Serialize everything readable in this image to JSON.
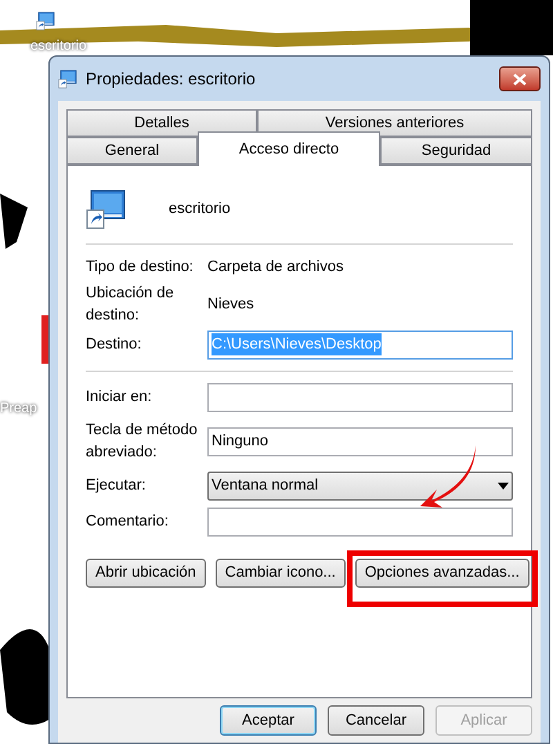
{
  "desktop": {
    "icons": [
      {
        "label": "escritorio"
      },
      {
        "label": "Preap"
      }
    ]
  },
  "window": {
    "title": "Propiedades: escritorio"
  },
  "tab_rows": [
    {
      "tabs": [
        {
          "label": "Detalles",
          "selected": false
        },
        {
          "label": "Versiones anteriores",
          "selected": false
        }
      ]
    },
    {
      "tabs": [
        {
          "label": "General",
          "selected": false
        },
        {
          "label": "Acceso directo",
          "selected": true
        },
        {
          "label": "Seguridad",
          "selected": false
        }
      ]
    }
  ],
  "shortcut_name": "escritorio",
  "info": [
    {
      "label": "Tipo de destino:",
      "value": "Carpeta de archivos"
    },
    {
      "label": "Ubicación de destino:",
      "value": "Nieves"
    }
  ],
  "fields": [
    {
      "kind": "text",
      "label": "Destino:",
      "value": "C:\\Users\\Nieves\\Desktop",
      "highlighted": true
    },
    {
      "kind": "separator"
    },
    {
      "kind": "text",
      "label": "Iniciar en:"
    },
    {
      "kind": "text",
      "label": "Tecla de método abreviado:",
      "value": "Ninguno",
      "highlighted": false
    },
    {
      "kind": "select",
      "label": "Ejecutar:",
      "value": "Ventana normal"
    },
    {
      "kind": "text",
      "label": "Comentario:"
    }
  ],
  "action_buttons": [
    {
      "label": "Abrir ubicación",
      "annotated": false
    },
    {
      "label": "Cambiar icono...",
      "annotated": false
    },
    {
      "label": "Opciones avanzadas...",
      "annotated": true
    }
  ],
  "dialog_buttons": [
    {
      "label": "Aceptar",
      "default": true,
      "disabled": false
    },
    {
      "label": "Cancelar",
      "default": false,
      "disabled": false
    },
    {
      "label": "Aplicar",
      "default": false,
      "disabled": true
    }
  ]
}
